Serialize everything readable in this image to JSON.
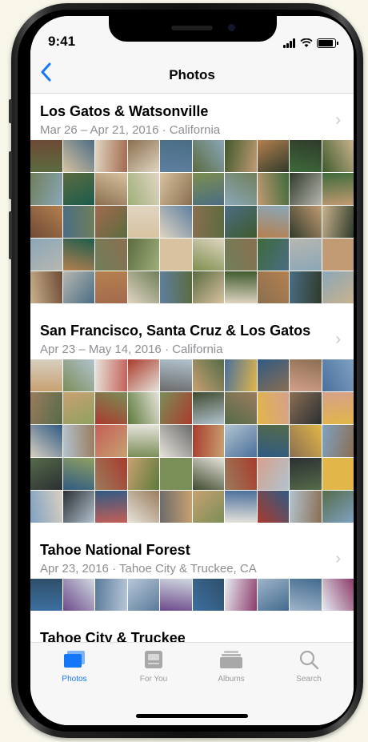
{
  "status": {
    "time": "9:41"
  },
  "nav": {
    "back_icon": "chevron-left-icon",
    "title": "Photos"
  },
  "moments": [
    {
      "title": "Los Gatos & Watsonville",
      "date": "Mar 26 – Apr 21, 2016",
      "location": "California",
      "palette": [
        "#5b6b3f",
        "#8a6f4f",
        "#c29a73",
        "#3e5a2c",
        "#9fb07a",
        "#6e4a35",
        "#b5804f",
        "#d8c2a0",
        "#4a6d84",
        "#2f3a2a",
        "#7d8f4d",
        "#a36a4d",
        "#c9b28d",
        "#6f7f5a",
        "#e0d5c2",
        "#8aa7b8",
        "#3d6a3a",
        "#5e7fa0",
        "#1c5c4c",
        "#b7b7b0"
      ]
    },
    {
      "title": "San Francisco, Santa Cruz & Los Gatos",
      "date": "Apr 23 – May 14, 2016",
      "location": "California",
      "palette": [
        "#c8a171",
        "#a93b2c",
        "#e2b648",
        "#4a6f9c",
        "#5c7a3a",
        "#d8cfc0",
        "#2f5a84",
        "#7a8e58",
        "#b2c3cf",
        "#8a6e52",
        "#3e4a2e",
        "#c45f57",
        "#7fa2c2",
        "#9a7c5d",
        "#e6e3da",
        "#556b49",
        "#d5a08b",
        "#6b6b6b",
        "#90a060",
        "#2b2f33"
      ]
    },
    {
      "title": "Tahoe National Forest",
      "date": "Apr 23, 2016",
      "location": "Tahoe City & Truckee, CA",
      "palette": [
        "#3c6fa0",
        "#b7c7d8",
        "#8c3b6a",
        "#e7edf2",
        "#5a7a9a",
        "#2f4f6a",
        "#a0b5c9",
        "#6d4a8c",
        "#d0d8e0",
        "#416a8e"
      ]
    },
    {
      "title": "Tahoe City & Truckee",
      "date": "",
      "location": "",
      "palette": [
        "#ffffff"
      ]
    }
  ],
  "tabs": [
    {
      "label": "Photos",
      "icon": "photos-icon",
      "active": true
    },
    {
      "label": "For You",
      "icon": "for-you-icon",
      "active": false
    },
    {
      "label": "Albums",
      "icon": "albums-icon",
      "active": false
    },
    {
      "label": "Search",
      "icon": "search-icon",
      "active": false
    }
  ],
  "colors": {
    "accent": "#1477f8",
    "inactive": "#9b9b9b",
    "subtitle": "#8e8e93"
  }
}
